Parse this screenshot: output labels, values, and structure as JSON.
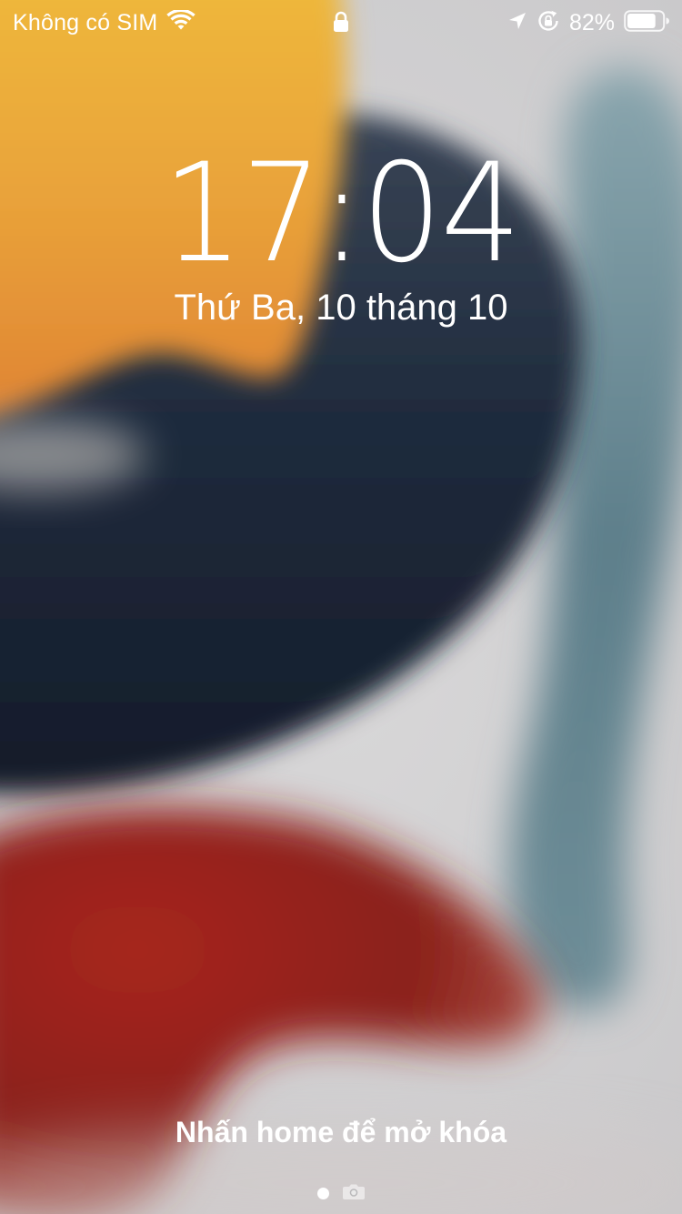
{
  "status_bar": {
    "carrier": "Không có SIM",
    "battery_percent": "82%",
    "battery_level": 0.82,
    "icons": {
      "wifi": "wifi-icon",
      "lock": "lock-icon",
      "location": "location-arrow-icon",
      "rotation_lock": "rotation-lock-icon",
      "battery": "battery-icon"
    }
  },
  "lock_screen": {
    "time": "17:04",
    "date": "Thứ Ba, 10 tháng 10",
    "unlock_hint": "Nhấn home để mở khóa"
  },
  "page_indicator": {
    "items": [
      "page-dot",
      "camera-icon"
    ],
    "active_index": 0
  },
  "colors": {
    "text": "#ffffff",
    "wallpaper_background": "#d3d2d3",
    "wallpaper_yellow": "#e9b43a",
    "wallpaper_orange": "#e08a35",
    "wallpaper_navy": "#1e2a3c",
    "wallpaper_teal": "#6f8f9a",
    "wallpaper_red": "#a52a22"
  }
}
